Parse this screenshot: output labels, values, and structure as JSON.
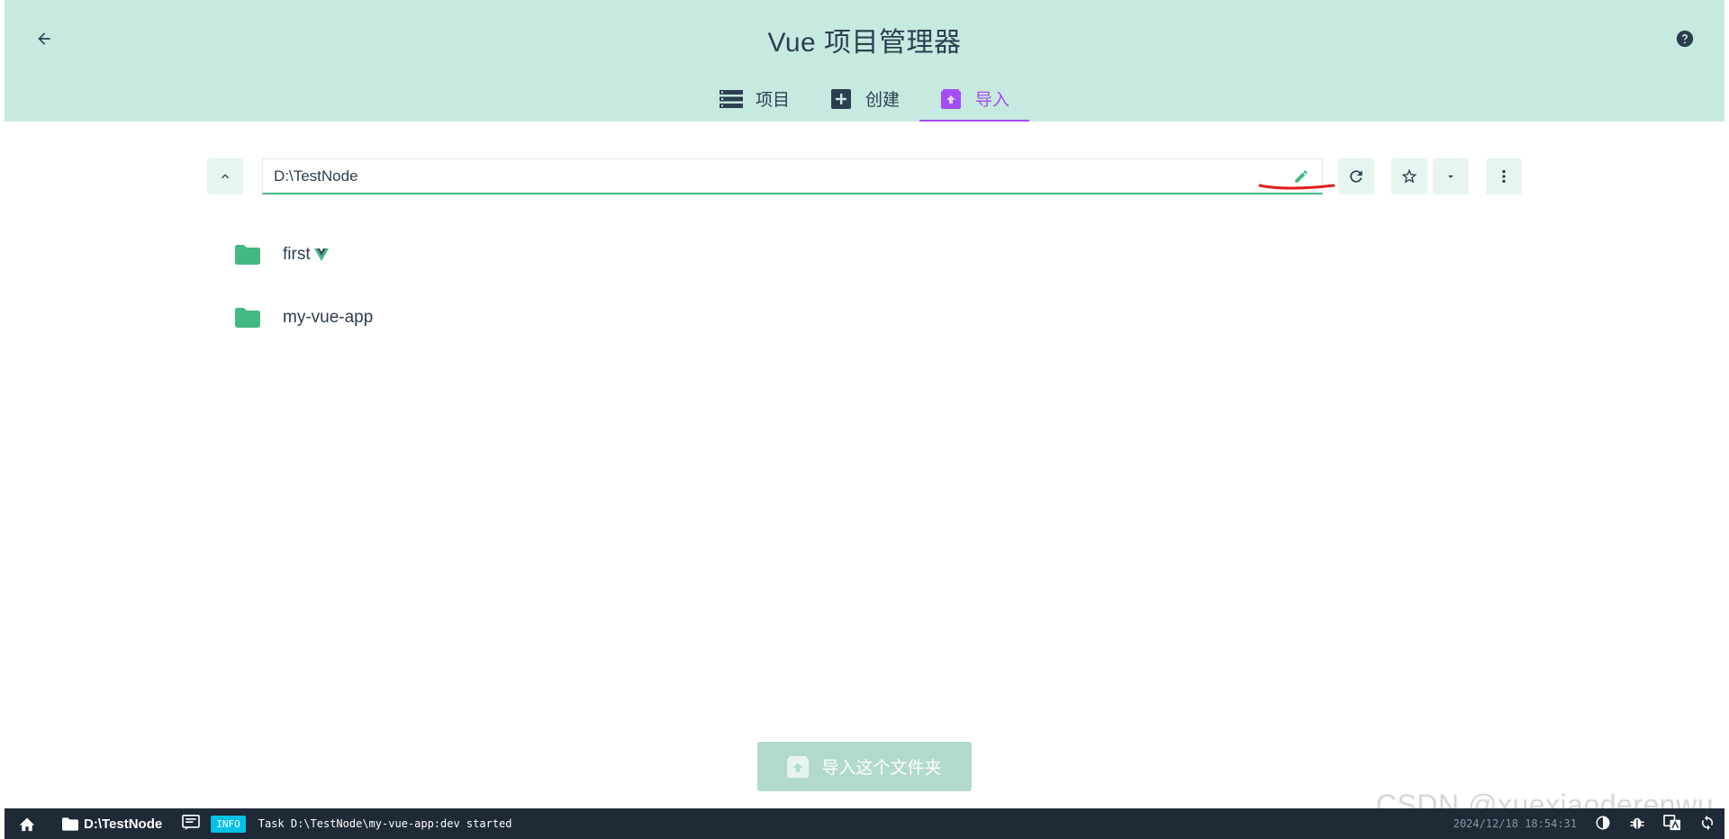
{
  "header": {
    "title": "Vue 项目管理器",
    "tabs": [
      {
        "label": "项目",
        "icon": "list-icon"
      },
      {
        "label": "创建",
        "icon": "add-box-icon"
      },
      {
        "label": "导入",
        "icon": "unarchive-icon",
        "active": true
      }
    ]
  },
  "toolbar": {
    "path_value": "D:\\TestNode"
  },
  "folders": [
    {
      "name": "first",
      "is_vue_project": true
    },
    {
      "name": "my-vue-app",
      "is_vue_project": false
    }
  ],
  "import_button": {
    "label": "导入这个文件夹"
  },
  "statusbar": {
    "cwd": "D:\\TestNode",
    "log_level": "INFO",
    "log_message": "Task D:\\TestNode\\my-vue-app:dev started",
    "timestamp": "2024/12/18 18:54:31"
  },
  "watermark": "CSDN @xuexiaoderenwu",
  "colors": {
    "header_bg": "#c6eadf",
    "accent_green": "#42b983",
    "active_tab": "#a44cf6",
    "statusbar_bg": "#1f2a37",
    "info_badge": "#03c2e6"
  }
}
